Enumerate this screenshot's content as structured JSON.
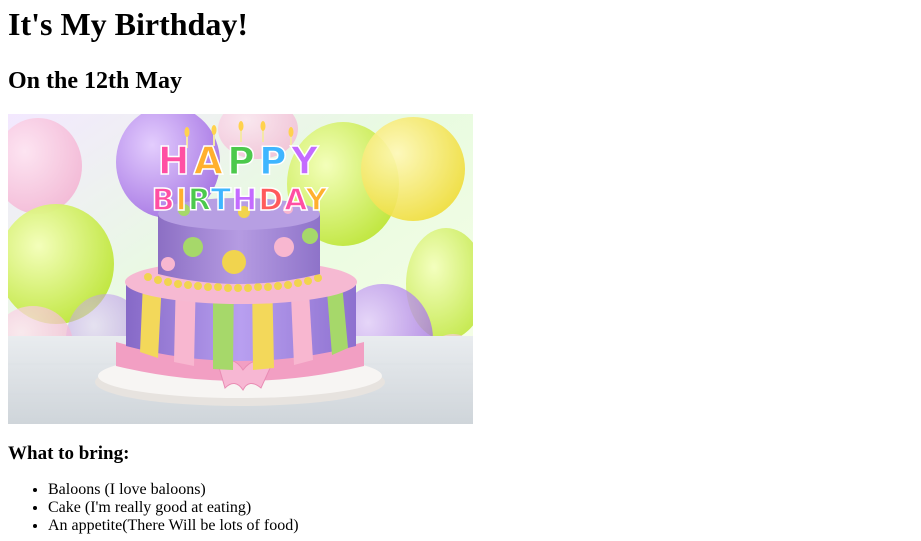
{
  "page": {
    "title": "It's My Birthday!",
    "subtitle": "On the 12th May"
  },
  "photo": {
    "topper_line1": "HAPPY",
    "topper_line2": "BIRTHDAY",
    "topper_colors": [
      "#ff4fa3",
      "#ffb02e",
      "#4cc94c",
      "#3fb6ff",
      "#c46bff",
      "#ff5a5a"
    ],
    "palette": {
      "background": "#d9f5c6",
      "cake_top": "#a98ad8",
      "cake_bottom": "#9f7fe0",
      "stripe_yellow": "#f3d85a",
      "stripe_green": "#a6d86a",
      "stripe_pink": "#f8b7d0",
      "ribbon": "#f7a9c8",
      "plate": "#f4f1ef"
    }
  },
  "bring": {
    "heading": "What to bring:",
    "items": [
      "Baloons (I love baloons)",
      "Cake (I'm really good at eating)",
      "An appetite(There Will be lots of food)"
    ]
  }
}
